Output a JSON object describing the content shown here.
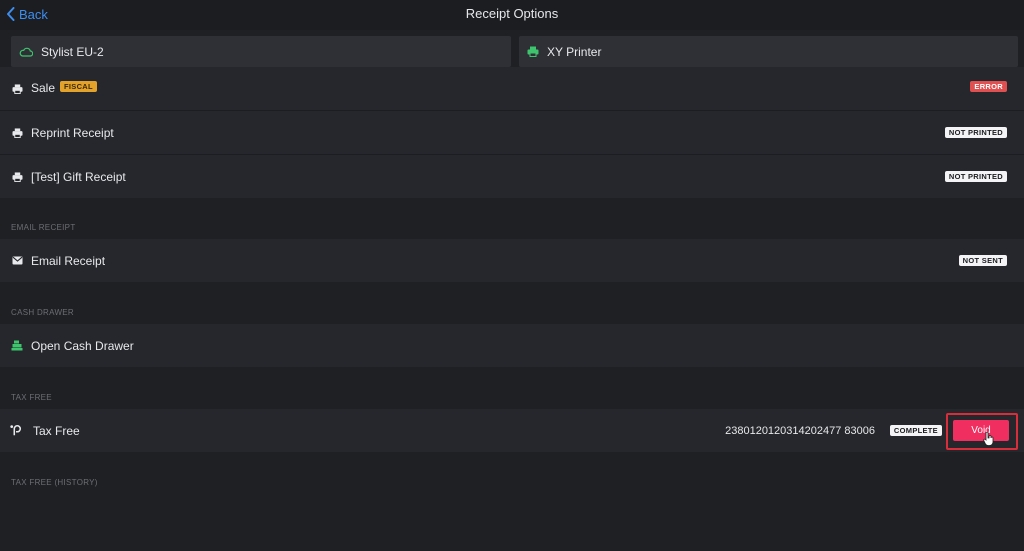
{
  "header": {
    "back_label": "Back",
    "title": "Receipt Options"
  },
  "selectors": {
    "device": "Stylist EU-2",
    "printer": "XY Printer"
  },
  "print_rows": [
    {
      "label": "Sale",
      "tag": "FISCAL",
      "status": "ERROR"
    },
    {
      "label": "Reprint Receipt",
      "status": "NOT PRINTED"
    },
    {
      "label": "[Test] Gift Receipt",
      "status": "NOT PRINTED"
    }
  ],
  "email": {
    "section": "EMAIL RECEIPT",
    "label": "Email Receipt",
    "status": "NOT SENT"
  },
  "cash_drawer": {
    "section": "CASH DRAWER",
    "label": "Open Cash Drawer"
  },
  "tax_free": {
    "section": "TAX FREE",
    "label": "Tax Free",
    "number": "2380120120314202477 83006",
    "status": "COMPLETE",
    "void_label": "Void"
  },
  "tax_free_history": {
    "section": "TAX FREE (HISTORY)"
  },
  "colors": {
    "accent_blue": "#3d8ef0",
    "error": "#e05050",
    "fiscal": "#e3a32a",
    "void": "#f02e60",
    "highlight": "#d82d3a",
    "green_icon": "#3ec46d"
  }
}
